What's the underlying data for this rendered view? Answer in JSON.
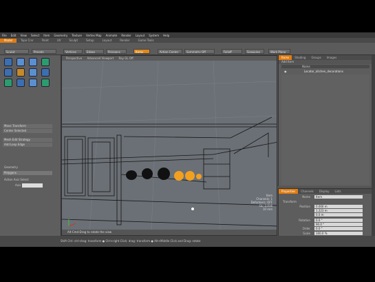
{
  "menubar": [
    "File",
    "Edit",
    "View",
    "Select",
    "Item",
    "Geometry",
    "Texture",
    "Vertex Map",
    "Animate",
    "Render",
    "Layout",
    "System",
    "Help"
  ],
  "tabs": [
    "Model",
    "Topo Crvr",
    "Paint",
    "UV",
    "Sculpt",
    "Setup",
    "Layout",
    "Render",
    "Game Tools"
  ],
  "toolbar": {
    "left": [
      "Sculpt",
      "Presets"
    ],
    "modes": [
      "Vertices",
      "Edges",
      "Polygons",
      "Items"
    ],
    "extra": [
      "Action Center",
      "Symmetry Off",
      "Falloff",
      "Snapping",
      "Work Plane"
    ]
  },
  "leftpanel": {
    "rows": [
      "Move Transform",
      "Center Selected",
      "Mesh Edit Strategy",
      "Add Loop Edge"
    ],
    "section": "Geometry",
    "sub_rows": [
      "Polygons",
      "Action Axis Select"
    ],
    "value_label": "Axis"
  },
  "viewport": {
    "header": [
      "Perspective",
      "Advanced Viewport",
      "Ray GL Off"
    ],
    "info": [
      "Item",
      "Channels: 1",
      "Deformers: OFF",
      "GL: 2,016",
      "10 mm"
    ],
    "footer": "Alt-Cmd-Drag to rotate the view"
  },
  "rightTop": {
    "tabs": [
      "Items",
      "Shading",
      "Groups",
      "Images"
    ],
    "sub": "Add Item",
    "header": "Name",
    "item": "Locator_kitchen_decorations"
  },
  "rightBot": {
    "tabs": [
      "Properties",
      "Channels",
      "Display",
      "Lists"
    ],
    "name_label": "Name",
    "name_value": "Item",
    "section": "Transform",
    "fields": [
      {
        "label": "Position",
        "value": "0.000 m"
      },
      {
        "label": "",
        "value": "1.223 m"
      },
      {
        "label": "",
        "value": "0.0 m"
      },
      {
        "label": "Rotation",
        "value": "0.0 °"
      },
      {
        "label": "",
        "value": "90.0 °"
      },
      {
        "label": "Order",
        "value": "0.0 °"
      },
      {
        "label": "Scale",
        "value": "100.0 %"
      },
      {
        "label": "",
        "value": "100.0 %"
      },
      {
        "label": "",
        "value": "100.0 %"
      }
    ]
  },
  "status": "Shift Ctrl: ctrl-drag: transform ● Ctrl+right Click: drag: transform ● Alt+Middle Click and Drag: rotate",
  "colors": {
    "accent": "#e07c12",
    "pot_black": "#111111",
    "pot_orange": "#f2a020"
  }
}
